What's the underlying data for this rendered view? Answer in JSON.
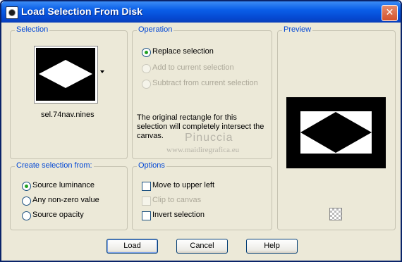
{
  "window": {
    "title": "Load Selection From Disk",
    "close_glyph": "✕"
  },
  "selection": {
    "legend": "Selection",
    "filename": "sel.74nav.nines"
  },
  "operation": {
    "legend": "Operation",
    "options": [
      {
        "label": "Replace selection",
        "checked": true,
        "enabled": true
      },
      {
        "label": "Add to current selection",
        "checked": false,
        "enabled": false
      },
      {
        "label": "Subtract from current selection",
        "checked": false,
        "enabled": false
      }
    ],
    "note": "The original rectangle for this selection will completely intersect the canvas."
  },
  "preview": {
    "legend": "Preview"
  },
  "create_from": {
    "legend": "Create selection from:",
    "options": [
      {
        "label": "Source luminance",
        "checked": true
      },
      {
        "label": "Any non-zero value",
        "checked": false
      },
      {
        "label": "Source opacity",
        "checked": false
      }
    ]
  },
  "options": {
    "legend": "Options",
    "items": [
      {
        "label": "Move to upper left",
        "checked": false,
        "enabled": true
      },
      {
        "label": "Clip to canvas",
        "checked": false,
        "enabled": false
      },
      {
        "label": "Invert selection",
        "checked": false,
        "enabled": true
      }
    ]
  },
  "buttons": {
    "load": "Load",
    "cancel": "Cancel",
    "help": "Help"
  },
  "watermark": {
    "name": "Pinuccia",
    "url": "www.maidiregrafica.eu"
  },
  "colors": {
    "title_bar": "#0a5ee8",
    "legend_text": "#0046d5",
    "dialog_bg": "#ece9d8",
    "radio_dot": "#21a121"
  }
}
